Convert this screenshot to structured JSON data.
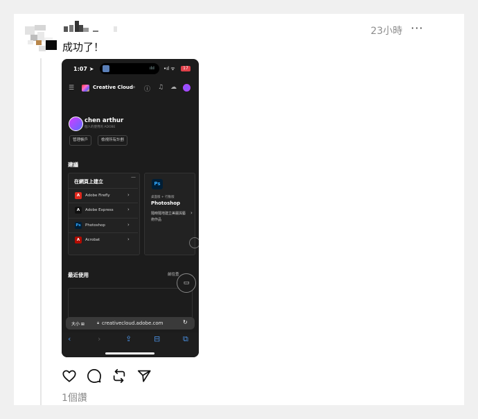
{
  "post": {
    "timestamp": "23小時",
    "more_label": "···",
    "text": "成功了！",
    "reads": "1個讚"
  },
  "phone": {
    "status": {
      "time": "1:07",
      "signal": "•ıl ᯤ",
      "battery": "17"
    },
    "header": {
      "app_title": "Creative Cloud"
    },
    "profile": {
      "name": "chen arthur",
      "subtitle": "個人的使用的 ADOBE",
      "chips": [
        "管理帳戶",
        "檢視所有計劃"
      ]
    },
    "suggestions": {
      "title": "建議",
      "panel_title": "在網頁上建立",
      "apps": [
        {
          "name": "Adobe Firefly",
          "icon": "firefly-icon",
          "color": "#e0291e",
          "glyph": "A"
        },
        {
          "name": "Adobe Express",
          "icon": "express-icon",
          "color": "#111111",
          "glyph": "A"
        },
        {
          "name": "Photoshop",
          "icon": "photoshop-icon",
          "color": "#001e36",
          "glyph": "Ps"
        },
        {
          "name": "Acrobat",
          "icon": "acrobat-icon",
          "color": "#b30b00",
          "glyph": "A"
        }
      ],
      "card": {
        "badge": "Ps",
        "subtitle": "桌面版 + 行動版",
        "title": "Photoshop",
        "description": "隨時隨地建立美麗與藝術作品"
      }
    },
    "recent": {
      "title": "最近使用",
      "link": "前往查"
    },
    "browser": {
      "aa_label": "大小",
      "url": "creativecloud.adobe.com"
    }
  },
  "colors": {
    "accent": "#4a90e2",
    "background": "#ffffff",
    "phone_bg": "#1c1c1c"
  }
}
